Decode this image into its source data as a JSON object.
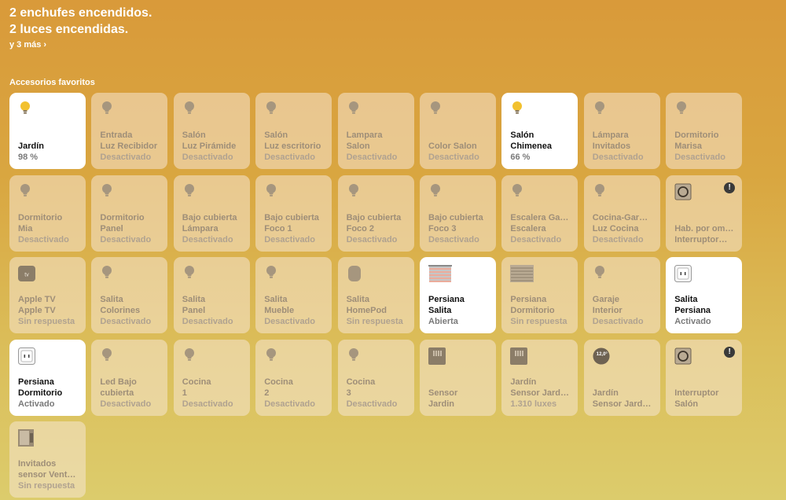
{
  "status": {
    "line1": "2 enchufes encendidos.",
    "line2": "2 luces encendidas.",
    "more": "y 3 más ›"
  },
  "section_title": "Accesorios favoritos",
  "tiles": [
    {
      "icon": "bulb-on",
      "l1": "Jardín",
      "l2": "",
      "st": "98 %",
      "on": true
    },
    {
      "icon": "bulb",
      "l1": "Entrada",
      "l2": "Luz Recibidor",
      "st": "Desactivado",
      "on": false
    },
    {
      "icon": "bulb",
      "l1": "Salón",
      "l2": "Luz Pirámide",
      "st": "Desactivado",
      "on": false
    },
    {
      "icon": "bulb",
      "l1": "Salón",
      "l2": "Luz escritorio",
      "st": "Desactivado",
      "on": false
    },
    {
      "icon": "bulb",
      "l1": "Lampara",
      "l2": "Salon",
      "st": "Desactivado",
      "on": false
    },
    {
      "icon": "bulb",
      "l1": "Color Salon",
      "l2": "",
      "st": "Desactivado",
      "on": false
    },
    {
      "icon": "bulb-on",
      "l1": "Salón",
      "l2": "Chimenea",
      "st": "66 %",
      "on": true
    },
    {
      "icon": "bulb",
      "l1": "Lámpara",
      "l2": "Invitados",
      "st": "Desactivado",
      "on": false
    },
    {
      "icon": "bulb",
      "l1": "Dormitorio",
      "l2": "Marisa",
      "st": "Desactivado",
      "on": false
    },
    {
      "icon": "bulb",
      "l1": "Dormitorio",
      "l2": "Mia",
      "st": "Desactivado",
      "on": false
    },
    {
      "icon": "bulb",
      "l1": "Dormitorio",
      "l2": "Panel",
      "st": "Desactivado",
      "on": false
    },
    {
      "icon": "bulb",
      "l1": "Bajo cubierta",
      "l2": "Lámpara",
      "st": "Desactivado",
      "on": false
    },
    {
      "icon": "bulb",
      "l1": "Bajo cubierta",
      "l2": "Foco 1",
      "st": "Desactivado",
      "on": false
    },
    {
      "icon": "bulb",
      "l1": "Bajo cubierta",
      "l2": "Foco 2",
      "st": "Desactivado",
      "on": false
    },
    {
      "icon": "bulb",
      "l1": "Bajo cubierta",
      "l2": "Foco 3",
      "st": "Desactivado",
      "on": false
    },
    {
      "icon": "bulb",
      "l1": "Escalera Ga…",
      "l2": "Escalera",
      "st": "Desactivado",
      "on": false
    },
    {
      "icon": "bulb",
      "l1": "Cocina-Gar…",
      "l2": "Luz Cocina",
      "st": "Desactivado",
      "on": false
    },
    {
      "icon": "switch",
      "l1": "Hab. por om…",
      "l2": "Interruptor…",
      "st": "",
      "on": false,
      "warn": true
    },
    {
      "icon": "appletv",
      "l1": "Apple TV",
      "l2": "Apple TV",
      "st": "Sin respuesta",
      "on": false
    },
    {
      "icon": "bulb",
      "l1": "Salita",
      "l2": "Colorines",
      "st": "Desactivado",
      "on": false
    },
    {
      "icon": "bulb",
      "l1": "Salita",
      "l2": "Panel",
      "st": "Desactivado",
      "on": false
    },
    {
      "icon": "bulb",
      "l1": "Salita",
      "l2": "Mueble",
      "st": "Desactivado",
      "on": false
    },
    {
      "icon": "homepod",
      "l1": "Salita",
      "l2": "HomePod",
      "st": "Sin respuesta",
      "on": false
    },
    {
      "icon": "blind-open",
      "l1": "Persiana",
      "l2": "Salita",
      "st": "Abierta",
      "on": true
    },
    {
      "icon": "blind",
      "l1": "Persiana",
      "l2": "Dormitorio",
      "st": "Sin respuesta",
      "on": false
    },
    {
      "icon": "bulb",
      "l1": "Garaje",
      "l2": "Interior",
      "st": "Desactivado",
      "on": false
    },
    {
      "icon": "outlet",
      "l1": "Salita",
      "l2": "Persiana",
      "st": "Activado",
      "on": true
    },
    {
      "icon": "outlet",
      "l1": "Persiana",
      "l2": "Dormitorio",
      "st": "Activado",
      "on": true
    },
    {
      "icon": "bulb",
      "l1": "Led Bajo",
      "l2": "cubierta",
      "st": "Desactivado",
      "on": false
    },
    {
      "icon": "bulb",
      "l1": "Cocina",
      "l2": "1",
      "st": "Desactivado",
      "on": false
    },
    {
      "icon": "bulb",
      "l1": "Cocina",
      "l2": "2",
      "st": "Desactivado",
      "on": false
    },
    {
      "icon": "bulb",
      "l1": "Cocina",
      "l2": "3",
      "st": "Desactivado",
      "on": false
    },
    {
      "icon": "sensor",
      "l1": "Sensor",
      "l2": "Jardin",
      "st": "",
      "on": false
    },
    {
      "icon": "sensor",
      "l1": "Jardín",
      "l2": "Sensor Jard…",
      "st": "1.310 luxes",
      "on": false
    },
    {
      "icon": "temp",
      "l1": "Jardín",
      "l2": "Sensor Jard…",
      "st": "",
      "on": false,
      "badge": "12,0°"
    },
    {
      "icon": "switch",
      "l1": "Interruptor",
      "l2": "Salón",
      "st": "",
      "on": false,
      "warn": true
    },
    {
      "icon": "window-sensor",
      "l1": "Invitados",
      "l2": "sensor Vent…",
      "st": "Sin respuesta",
      "on": false
    }
  ]
}
